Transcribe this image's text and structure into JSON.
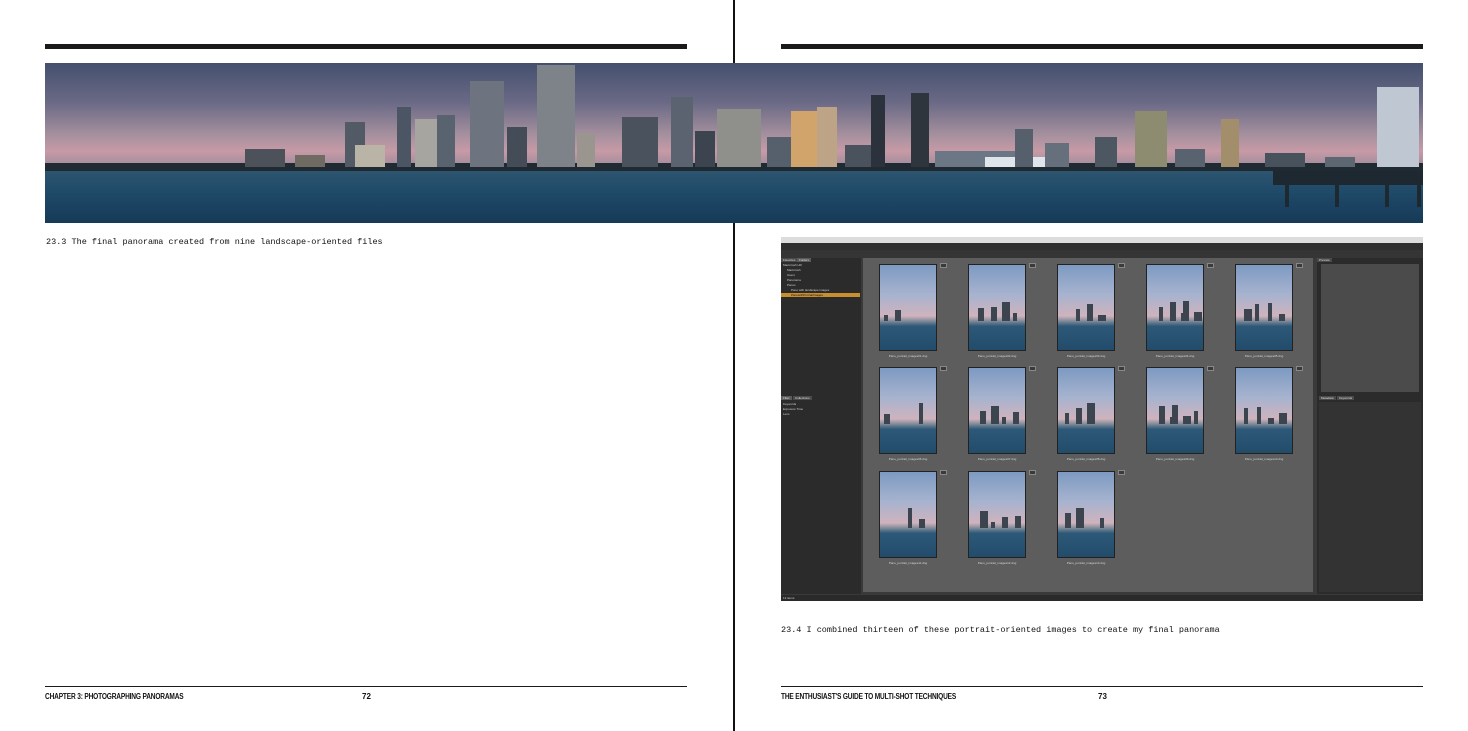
{
  "left_page": {
    "caption": "23.3 The final panorama created from nine landscape-oriented files",
    "footer_title": "CHAPTER 3: PHOTOGRAPHING PANORAMAS",
    "page_number": "72"
  },
  "right_page": {
    "caption": "23.4 I combined thirteen of these portrait-oriented images to create my final panorama",
    "footer_title": "THE ENTHUSIAST'S GUIDE TO MULTI-SHOT TECHNIQUES",
    "page_number": "73"
  },
  "bridge": {
    "workspace_tabs": [
      "Essentials",
      "Filmstrip",
      "Metadata",
      "Keywords"
    ],
    "left_tabs": [
      "Favorites",
      "Folders"
    ],
    "tree": [
      "Macintosh HD",
      "Macintosh",
      "Users",
      "Panorama",
      "Panos",
      "Pano with landscape images",
      "PanowithPortraitImages"
    ],
    "filter_tabs": [
      "Filter",
      "Collections"
    ],
    "filter_items": [
      "Keywords",
      "Exposure Time",
      "Lens"
    ],
    "right_tabs": [
      "Preview",
      "Metadata",
      "Keywords"
    ],
    "thumbnails": [
      "Pano_portrait_images01.dng",
      "Pano_portrait_images02.dng",
      "Pano_portrait_images03.dng",
      "Pano_portrait_images04.dng",
      "Pano_portrait_images05.dng",
      "Pano_portrait_images06.dng",
      "Pano_portrait_images07.dng",
      "Pano_portrait_images08.dng",
      "Pano_portrait_images09.dng",
      "Pano_portrait_images10.dng",
      "Pano_portrait_images11.dng",
      "Pano_portrait_images12.dng",
      "Pano_portrait_images13.dng"
    ],
    "status": "13 items"
  }
}
